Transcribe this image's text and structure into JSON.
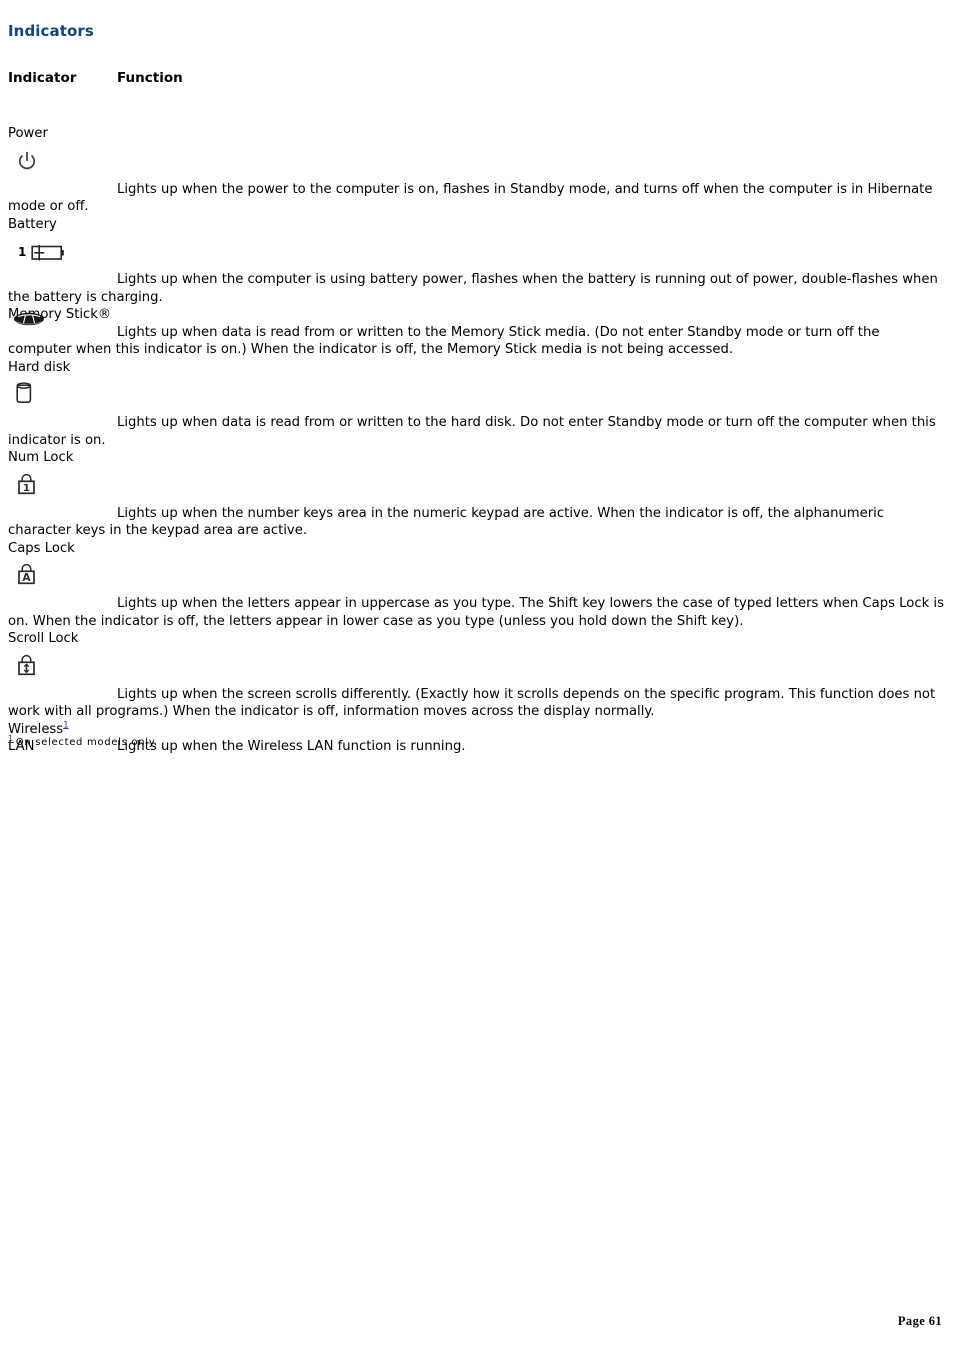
{
  "document": {
    "title": "Indicators",
    "title_color": "#14457e",
    "page_footer": "Page 61"
  },
  "table": {
    "headers": {
      "indicator": "Indicator",
      "function": "Function"
    },
    "rows": [
      {
        "label": "Power",
        "icon": "power-icon",
        "description": "Lights up when the power to the computer is on, flashes in Standby mode, and turns off when the computer is in Hibernate mode or off."
      },
      {
        "label": "Battery",
        "icon": "battery-icon",
        "icon_prefix": "1",
        "description": "Lights up when the computer is using battery power, flashes when the battery is running out of power, double-flashes when the battery is charging."
      },
      {
        "label": "Memory Stick®",
        "icon": "memory-stick-icon",
        "description": "Lights up when data is read from or written to the Memory Stick media. (Do not enter Standby mode or turn off the computer when this indicator is on.) When the indicator is off, the Memory Stick media is not being accessed."
      },
      {
        "label": "Hard disk",
        "icon": "hard-disk-icon",
        "description": "Lights up when data is read from or written to the hard disk. Do not enter Standby mode or turn off the computer when this indicator is on."
      },
      {
        "label": "Num Lock",
        "icon": "num-lock-icon",
        "description": "Lights up when the number keys area in the numeric keypad are active. When the indicator is off, the alphanumeric character keys in the keypad area are active."
      },
      {
        "label": "Caps Lock",
        "icon": "caps-lock-icon",
        "description": "Lights up when the letters appear in uppercase as you type. The Shift key lowers the case of typed letters when Caps Lock is on. When the indicator is off, the letters appear in lower case as you type (unless you hold down the Shift key)."
      },
      {
        "label": "Scroll Lock",
        "icon": "scroll-lock-icon",
        "description": "Lights up when the screen scrolls differently. (Exactly how it scrolls depends on the specific program. This function does not work with all programs.) When the indicator is off, information moves across the display normally."
      },
      {
        "label": "Wireless",
        "label_footnote": "1",
        "label_line2": "LAN",
        "description": "Lights up when the Wireless LAN function is running."
      }
    ]
  },
  "footnote": {
    "marker": "1",
    "text": "On selected models only."
  }
}
